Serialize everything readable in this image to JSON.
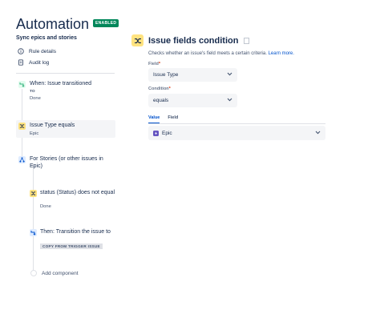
{
  "header": {
    "title": "Automation",
    "status_badge": "ENABLED"
  },
  "sidebar": {
    "rule_name": "Sync epics and stories",
    "menu": [
      {
        "label": "Rule details",
        "icon": "info-icon"
      },
      {
        "label": "Audit log",
        "icon": "document-icon"
      }
    ]
  },
  "flow": {
    "trigger": {
      "title": "When: Issue transitioned",
      "sub1": "TO",
      "sub2": "Done",
      "icon": "transition-icon",
      "color": "#36b37e"
    },
    "condition": {
      "title": "Issue Type equals",
      "sub": "Epic",
      "icon": "shuffle-icon",
      "color": "#ffe380"
    },
    "branch": {
      "title": "For Stories (or other issues in Epic)",
      "icon": "branch-icon",
      "color": "#deebff"
    },
    "branch_condition": {
      "title": "status (Status) does not equal",
      "sub": "Done",
      "icon": "shuffle-icon",
      "color": "#ffe380"
    },
    "action": {
      "title": "Then: Transition the issue to",
      "tag": "COPY FROM TRIGGER ISSUE",
      "icon": "transition-icon",
      "color": "#deebff"
    },
    "add_component": "Add component"
  },
  "panel": {
    "title": "Issue fields condition",
    "description": "Checks whether an issue's field meets a certain criteria.",
    "learn_more": "Learn more.",
    "field_label": "Field",
    "field_value": "Issue Type",
    "condition_label": "Condition",
    "condition_value": "equals",
    "tabs": [
      "Value",
      "Field"
    ],
    "value": "Epic"
  }
}
